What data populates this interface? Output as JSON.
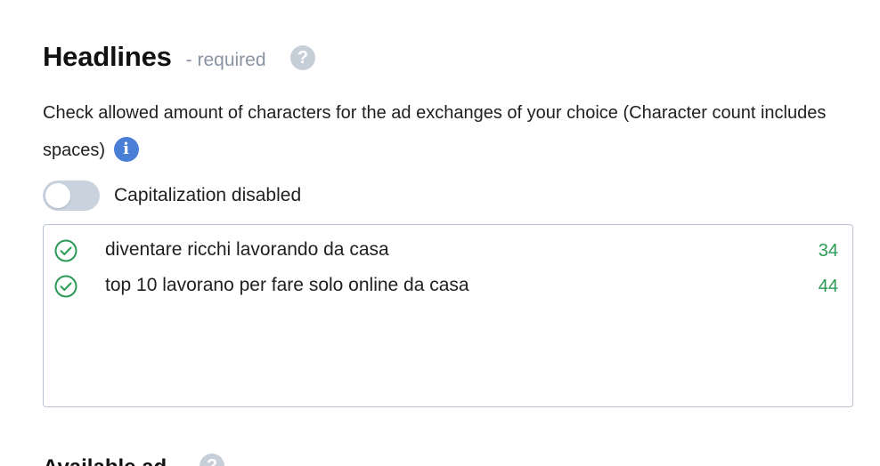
{
  "section": {
    "title": "Headlines",
    "required_label": "- required",
    "help_icon": "question-circle-icon"
  },
  "description": {
    "text": "Check allowed amount of characters for the ad exchanges of your choice (Character count includes spaces)",
    "info_icon": "info-circle-icon",
    "info_glyph": "i"
  },
  "toggle": {
    "label": "Capitalization disabled",
    "state": "off"
  },
  "headlines": [
    {
      "text": "diventare ricchi lavorando da casa",
      "count": "34",
      "status_icon": "check-circle-icon"
    },
    {
      "text": "top 10 lavorano per fare solo online da casa",
      "count": "44",
      "status_icon": "check-circle-icon"
    }
  ],
  "next_section": {
    "title": "Available ad",
    "help_glyph": "?"
  },
  "help_glyph": "?",
  "colors": {
    "accent_green": "#2a9a55",
    "info_blue": "#4a7fd6",
    "help_grey": "#c6ced8",
    "toggle_off": "#c9d3de",
    "border": "#b9c4d0"
  }
}
